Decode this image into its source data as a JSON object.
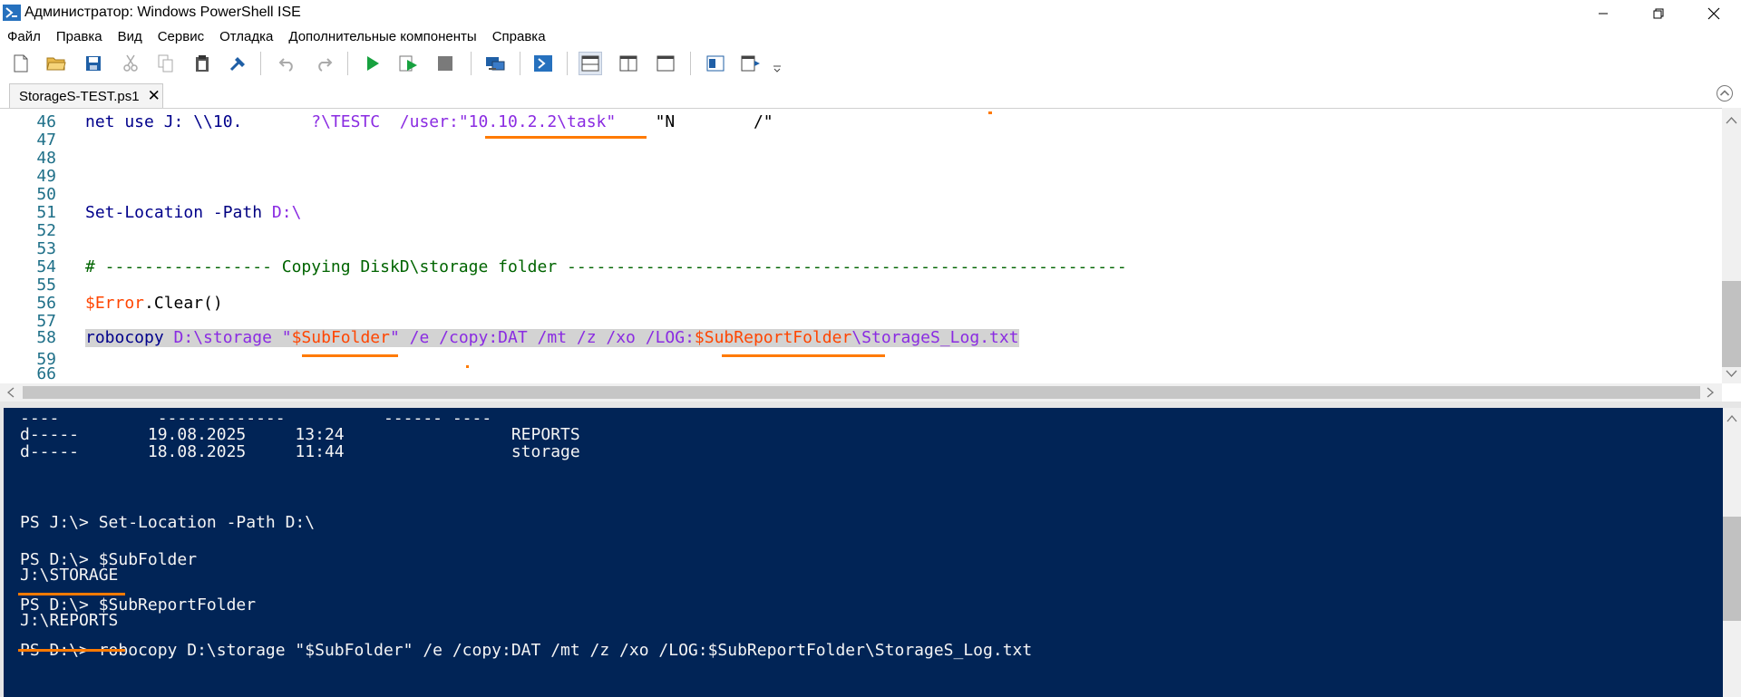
{
  "window": {
    "title": "Администратор: Windows PowerShell ISE",
    "app_icon": "powershell-ise-icon",
    "controls": [
      "minimize-icon",
      "restore-icon",
      "close-icon"
    ]
  },
  "menu": {
    "items": [
      "Файл",
      "Правка",
      "Вид",
      "Сервис",
      "Отладка",
      "Дополнительные компоненты",
      "Справка"
    ]
  },
  "toolbar": {
    "buttons": [
      "new-icon",
      "open-icon",
      "save-icon",
      "cut-icon",
      "copy-icon",
      "paste-icon",
      "clear-icon",
      "undo-icon",
      "redo-icon",
      "run-icon",
      "run-selection-icon",
      "stop-icon",
      "remote-icon",
      "start-powershell-icon",
      "show-script-pane-top-icon",
      "show-script-pane-right-icon",
      "maximize-script-pane-icon",
      "show-commands-icon",
      "show-addon-icon",
      "more-icon"
    ]
  },
  "tabs": [
    {
      "label": "StorageS-TEST.ps1",
      "close": "✕"
    }
  ],
  "editor": {
    "lines": [
      {
        "n": "46",
        "segs": [
          {
            "t": "net use J: \\\\10.",
            "c": "kw"
          },
          {
            "t": "       ",
            "c": "plain"
          },
          {
            "t": "?\\TESTC  /user:",
            "c": "str"
          },
          {
            "t": "\"10.10.2.2\\task\"",
            "c": "str"
          },
          {
            "t": "    ",
            "c": "plain"
          },
          {
            "t": "\"N",
            "c": "plain"
          },
          {
            "t": "        ",
            "c": "plain"
          },
          {
            "t": "/\"",
            "c": "plain"
          }
        ]
      },
      {
        "n": "47",
        "segs": []
      },
      {
        "n": "48",
        "segs": []
      },
      {
        "n": "49",
        "segs": []
      },
      {
        "n": "50",
        "segs": []
      },
      {
        "n": "51",
        "segs": [
          {
            "t": "Set-Location",
            "c": "kw"
          },
          {
            "t": " -Path",
            "c": "param"
          },
          {
            "t": " D:\\",
            "c": "arg"
          }
        ]
      },
      {
        "n": "52",
        "segs": []
      },
      {
        "n": "53",
        "segs": []
      },
      {
        "n": "54",
        "segs": [
          {
            "t": "# ----------------- Copying DiskD\\storage folder ---------------------------------------------------------",
            "c": "comment"
          }
        ]
      },
      {
        "n": "55",
        "segs": []
      },
      {
        "n": "56",
        "segs": [
          {
            "t": "$Error",
            "c": "var"
          },
          {
            "t": ".Clear()",
            "c": "plain"
          }
        ]
      },
      {
        "n": "57",
        "segs": []
      },
      {
        "n": "58",
        "selected": true,
        "segs": [
          {
            "t": "robocopy",
            "c": "kw"
          },
          {
            "t": " D:\\storage ",
            "c": "arg"
          },
          {
            "t": "\"",
            "c": "str"
          },
          {
            "t": "$SubFolder",
            "c": "var"
          },
          {
            "t": "\"",
            "c": "str"
          },
          {
            "t": " /e /copy:DAT /mt /z /xo /LOG:",
            "c": "arg"
          },
          {
            "t": "$SubReportFolder",
            "c": "var"
          },
          {
            "t": "\\StorageS_Log.txt",
            "c": "arg"
          }
        ]
      },
      {
        "n": "59",
        "segs": []
      },
      {
        "n": "66",
        "segs": []
      }
    ]
  },
  "console": {
    "lines": [
      "----          -------------          ------ ----",
      "d-----       19.08.2025     13:24                 REPORTS",
      "d-----       18.08.2025     11:44                 storage",
      "",
      "",
      "",
      "PS J:\\> Set-Location -Path D:\\",
      "",
      "PS D:\\> $SubFolder",
      "J:\\STORAGE",
      "",
      "PS D:\\> $SubReportFolder",
      "J:\\REPORTS",
      "",
      "PS D:\\> robocopy D:\\storage \"$SubFolder\" /e /copy:DAT /mt /z /xo /LOG:$SubReportFolder\\StorageS_Log.txt"
    ]
  },
  "colors": {
    "console_bg": "#012456",
    "accent_underline": "#ff7a00"
  }
}
